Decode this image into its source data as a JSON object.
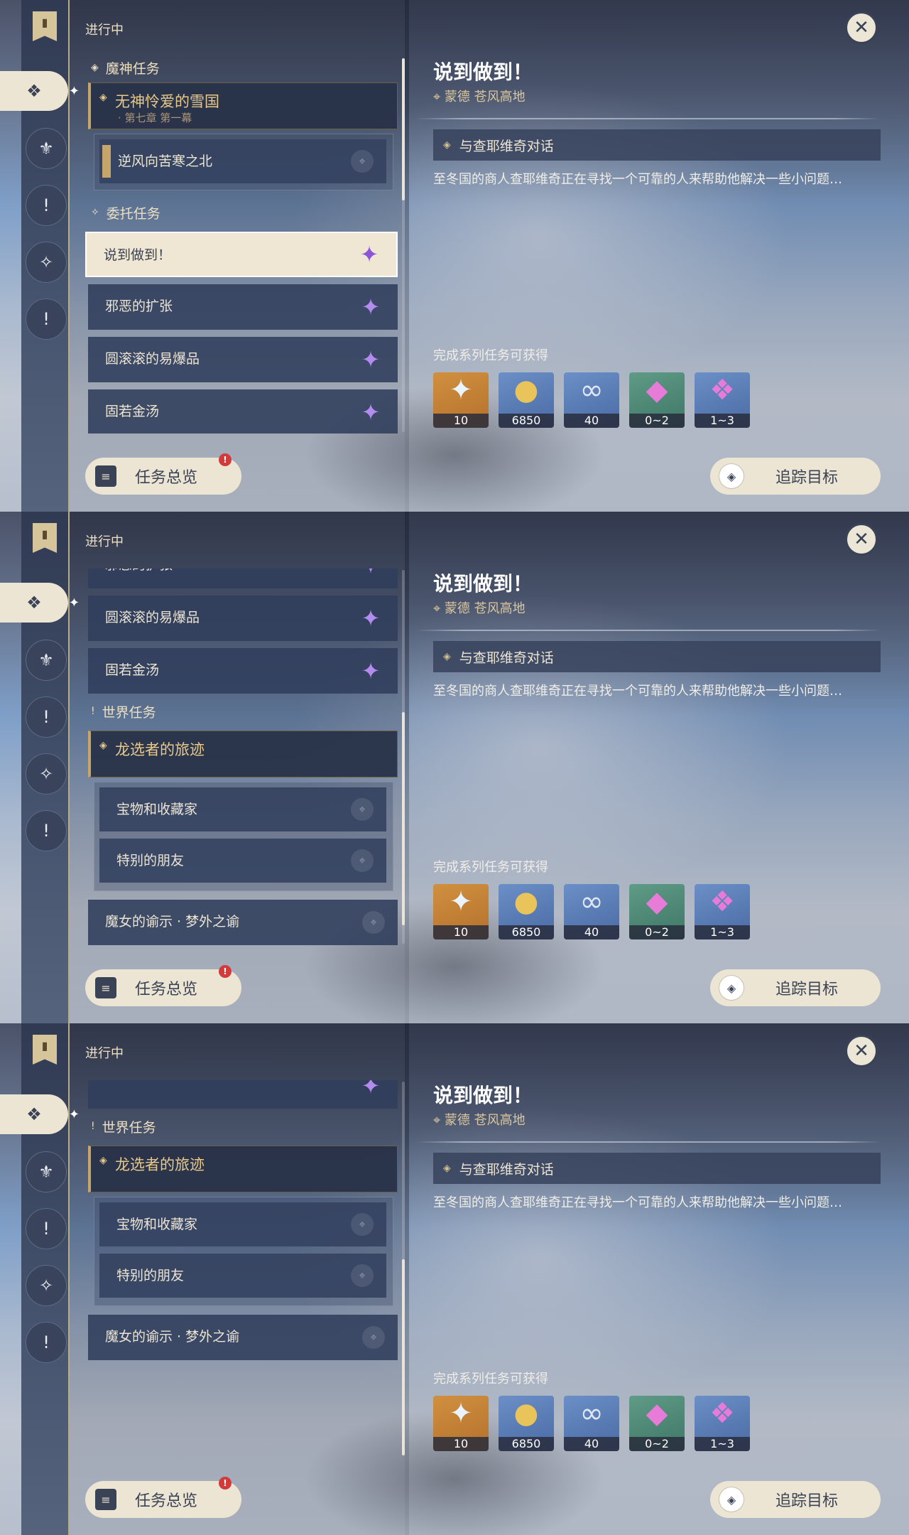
{
  "common": {
    "in_progress_label": "进行中",
    "close_symbol": "✕",
    "quest": {
      "title": "说到做到！",
      "location": "蒙德 苍风高地",
      "step": "与查耶维奇对话",
      "description": "至冬国的商人查耶维奇正在寻找一个可靠的人来帮助他解决一些小问题…",
      "rewards_title": "完成系列任务可获得",
      "rewards": [
        {
          "icon": "primogem-icon",
          "count": "10",
          "bg": "orange"
        },
        {
          "icon": "mora-icon",
          "count": "6850",
          "bg": "blue"
        },
        {
          "icon": "adventure-exp-icon",
          "count": "40",
          "bg": "blue"
        },
        {
          "icon": "crystal-icon",
          "count": "0~2",
          "bg": "green"
        },
        {
          "icon": "crystal-cluster-icon",
          "count": "1~3",
          "bg": "blue"
        }
      ]
    },
    "overview_button": "任务总览",
    "track_button": "追踪目标",
    "badge": "!"
  },
  "quest_list": {
    "archon_category": "魔神任务",
    "archon_chapter": {
      "title": "无神怜爱的雪国",
      "subtitle": "· 第七章 第一幕"
    },
    "archon_sub": "逆风向苦寒之北",
    "commission_category": "委托任务",
    "commissions": [
      "说到做到！",
      "邪恶的扩张",
      "圆滚滚的易爆品",
      "固若金汤"
    ],
    "world_category": "世界任务",
    "world_chapter": "龙选者的旅迹",
    "world_subs": [
      "宝物和收藏家",
      "特别的朋友"
    ],
    "world_other": "魔女的谕示 · 梦外之谕"
  },
  "colors": {
    "accent_gold": "#c6a56a",
    "panel": "#ece5d3",
    "badge_red": "#d23b3b"
  }
}
